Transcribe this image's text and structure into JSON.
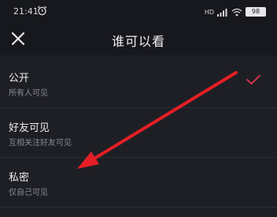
{
  "status_bar": {
    "time": "21:41",
    "alarm_icon": "alarm-clock-icon",
    "network": "HD",
    "battery": "98"
  },
  "header": {
    "title": "谁可以看",
    "close_icon": "close-icon"
  },
  "options": [
    {
      "label": "公开",
      "desc": "所有人可见",
      "selected": true
    },
    {
      "label": "好友可见",
      "desc": "互相关注好友可见",
      "selected": false
    },
    {
      "label": "私密",
      "desc": "仅自己可见",
      "selected": false
    }
  ],
  "colors": {
    "accent": "#e8364f",
    "annotation_arrow": "#e51e25",
    "background": "#1e1f25"
  }
}
